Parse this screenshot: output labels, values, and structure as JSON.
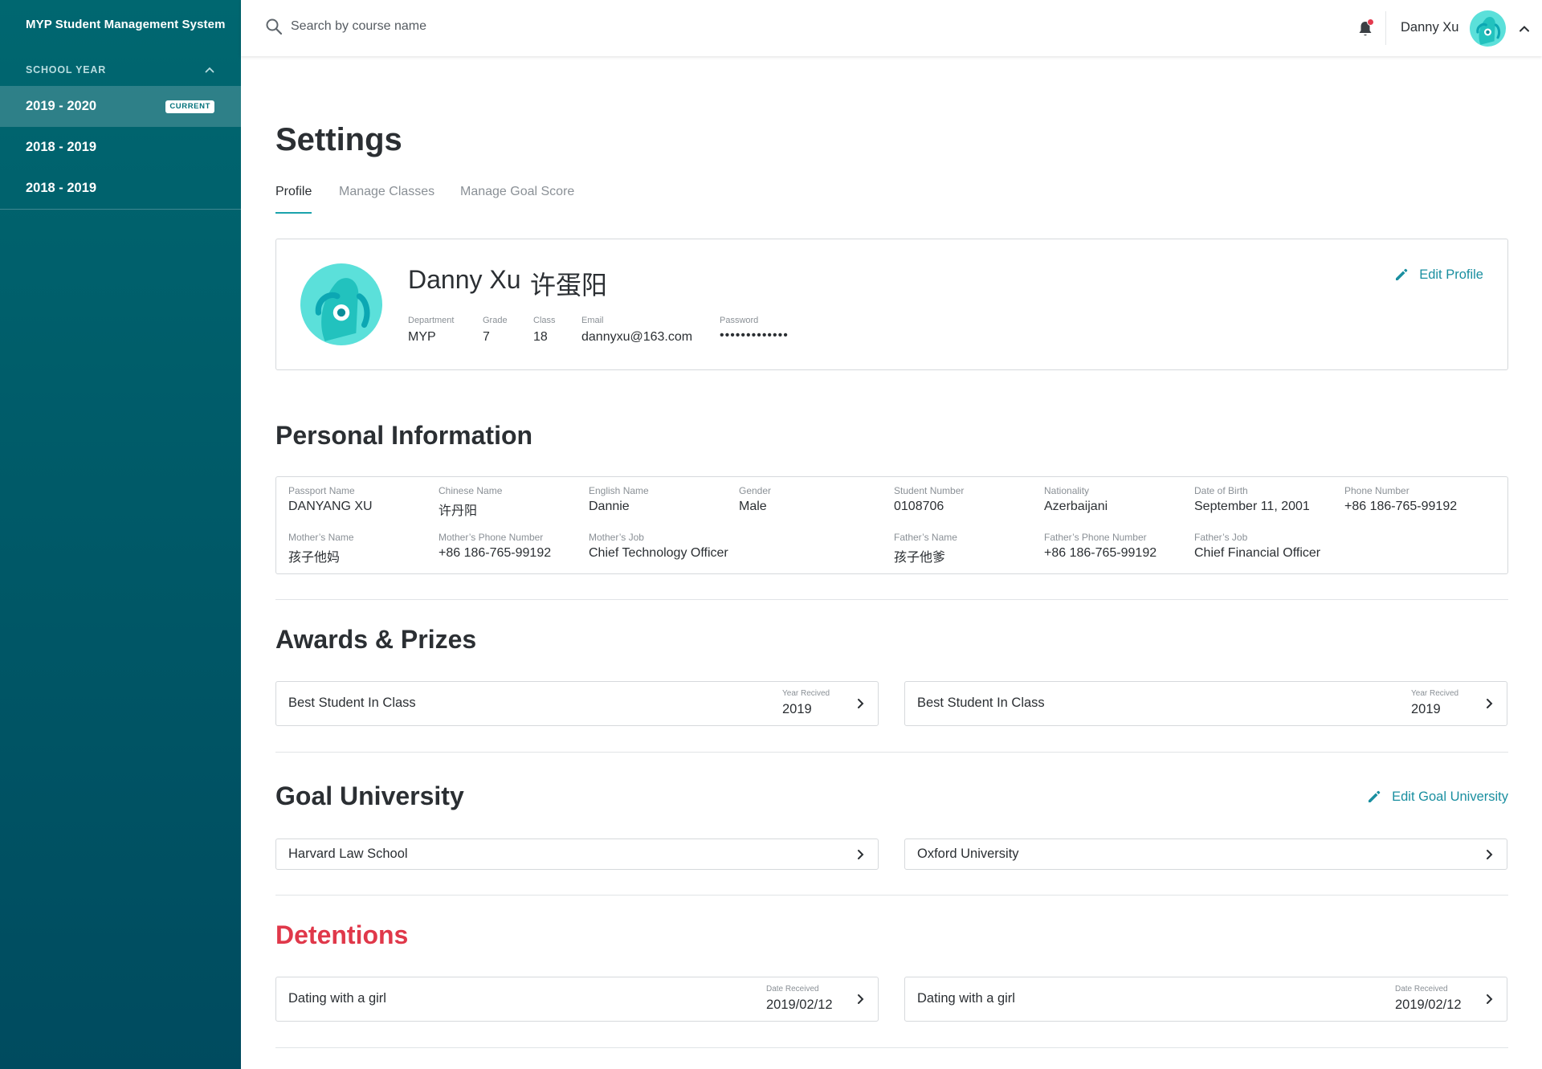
{
  "sidebar": {
    "brand": "MYP Student Management System",
    "school_year_label": "SCHOOL YEAR",
    "years": [
      {
        "label": "2019 - 2020",
        "badge": "CURRENT"
      },
      {
        "label": "2018 - 2019"
      },
      {
        "label": "2018 - 2019"
      }
    ]
  },
  "topbar": {
    "search_placeholder": "Search by course name",
    "user_name": "Danny Xu"
  },
  "page": {
    "title": "Settings",
    "tabs": [
      "Profile",
      "Manage Classes",
      "Manage Goal Score"
    ],
    "active_tab": "Profile"
  },
  "profile": {
    "name": "Danny Xu",
    "chinese_name": "许蛋阳",
    "edit_label": "Edit Profile",
    "fields": [
      {
        "label": "Department",
        "value": "MYP"
      },
      {
        "label": "Grade",
        "value": "7"
      },
      {
        "label": "Class",
        "value": "18"
      },
      {
        "label": "Email",
        "value": "dannyxu@163.com"
      },
      {
        "label": "Password",
        "value": "•••••••••••••"
      }
    ]
  },
  "personal_info": {
    "title": "Personal Information",
    "row1": [
      {
        "label": "Passport Name",
        "value": "DANYANG XU"
      },
      {
        "label": "Chinese Name",
        "value": "许丹阳"
      },
      {
        "label": "English Name",
        "value": "Dannie"
      },
      {
        "label": "Gender",
        "value": "Male"
      },
      {
        "label": "Student Number",
        "value": "0108706"
      },
      {
        "label": "Nationality",
        "value": "Azerbaijani"
      },
      {
        "label": "Date of Birth",
        "value": "September 11, 2001"
      },
      {
        "label": "Phone Number",
        "value": "+86 186-765-99192"
      }
    ],
    "row2": [
      {
        "label": "Mother’s Name",
        "value": "孩子他妈"
      },
      {
        "label": "Mother’s Phone Number",
        "value": "+86 186-765-99192"
      },
      {
        "label": "Mother’s Job",
        "value": "Chief Technology Officer"
      },
      {
        "label": "Father’s Name",
        "value": "孩子他爹"
      },
      {
        "label": "Father’s Phone Number",
        "value": "+86 186-765-99192"
      },
      {
        "label": "Father’s Job",
        "value": "Chief Financial Officer"
      }
    ]
  },
  "awards": {
    "title": "Awards & Prizes",
    "items": [
      {
        "name": "Best Student In Class",
        "meta_label": "Year Recived",
        "meta_value": "2019"
      },
      {
        "name": "Best Student In Class",
        "meta_label": "Year Recived",
        "meta_value": "2019"
      }
    ]
  },
  "goal_university": {
    "title": "Goal University",
    "edit_label": "Edit Goal University",
    "items": [
      "Harvard Law School",
      "Oxford University"
    ]
  },
  "detentions": {
    "title": "Detentions",
    "items": [
      {
        "name": "Dating with a girl",
        "meta_label": "Date Received",
        "meta_value": "2019/02/12"
      },
      {
        "name": "Dating with a girl",
        "meta_label": "Date Received",
        "meta_value": "2019/02/12"
      }
    ]
  },
  "colors": {
    "sidebar_top": "#006770",
    "sidebar_bottom": "#004b5f",
    "accent": "#1a8fa0",
    "danger": "#e0384a",
    "notification_dot": "#e33a4e"
  },
  "icons": [
    "search-icon",
    "bell-icon",
    "chevron-up-icon",
    "chevron-right-icon",
    "pencil-icon",
    "avatar"
  ]
}
